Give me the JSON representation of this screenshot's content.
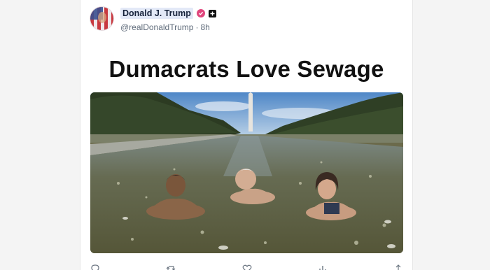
{
  "post": {
    "author_name": "Donald J. Trump",
    "handle": "@realDonaldTrump",
    "separator": "·",
    "time": "8h",
    "headline": "Dumacrats Love Sewage"
  },
  "icons": {
    "avatar": "flag-avatar",
    "verified": "verified-badge-icon",
    "affiliation": "plus-icon",
    "reply": "reply-icon",
    "repost": "repost-icon",
    "like": "heart-icon",
    "views": "views-icon",
    "share": "share-icon"
  },
  "colors": {
    "verified_badge": "#e0467d",
    "name_highlight": "#e3e9f7",
    "handle_text": "#5f6b7a"
  }
}
